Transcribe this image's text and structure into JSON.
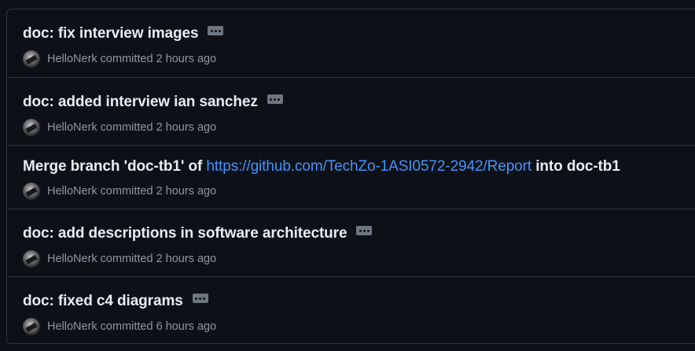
{
  "commits": [
    {
      "message": "doc: fix interview images",
      "author": "HelloNerk",
      "verb": "committed",
      "time": "2 hours ago"
    },
    {
      "message": "doc: added interview ian sanchez",
      "author": "HelloNerk",
      "verb": "committed",
      "time": "2 hours ago"
    },
    {
      "message_prefix": "Merge branch 'doc-tb1' of",
      "message_link": "https://github.com/TechZo-1ASI0572-2942/Report",
      "message_suffix": "into doc-tb1",
      "author": "HelloNerk",
      "verb": "committed",
      "time": "2 hours ago"
    },
    {
      "message": "doc: add descriptions in software architecture",
      "author": "HelloNerk",
      "verb": "committed",
      "time": "2 hours ago"
    },
    {
      "message": "doc: fixed c4 diagrams",
      "author": "HelloNerk",
      "verb": "committed",
      "time": "6 hours ago"
    }
  ],
  "icons": {
    "ellipsis": "kebab-horizontal-icon",
    "avatar": "user-avatar"
  }
}
